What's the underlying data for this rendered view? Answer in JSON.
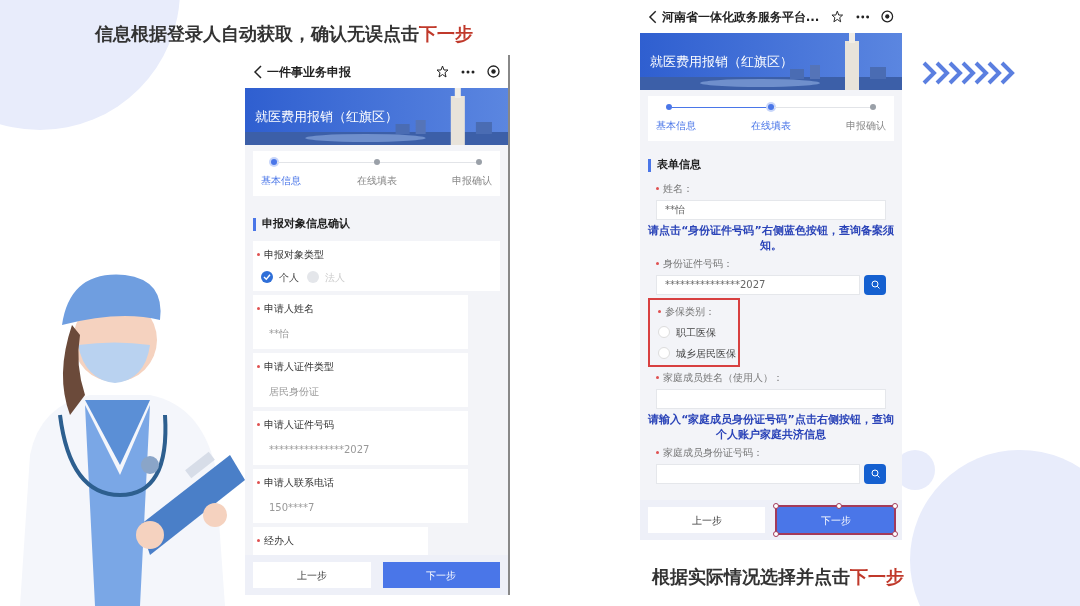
{
  "captions": [
    {
      "text": "信息根据登录人自动获取，确认无误点击",
      "highlight": "下一步"
    },
    {
      "text": "根据实际情况选择并点击",
      "highlight": "下一步"
    }
  ],
  "phones": [
    {
      "title": "一件事业务申报",
      "banner": "就医费用报销（红旗区）",
      "steps": [
        {
          "label": "基本信息",
          "completed": true,
          "current": true
        },
        {
          "label": "在线填表",
          "completed": false,
          "current": false
        },
        {
          "label": "申报确认",
          "completed": false,
          "current": false
        }
      ],
      "section": "申报对象信息确认",
      "items": [
        {
          "kind": "radio",
          "label": "申报对象类型",
          "required": true,
          "options": [
            {
              "label": "个人",
              "checked": true,
              "disabled": false
            },
            {
              "label": "法人",
              "checked": false,
              "disabled": true
            }
          ]
        },
        {
          "kind": "text",
          "label": "申请人姓名",
          "required": true,
          "value": "**怡"
        },
        {
          "kind": "text",
          "label": "申请人证件类型",
          "required": true,
          "value": "居民身份证"
        },
        {
          "kind": "text",
          "label": "申请人证件号码",
          "required": true,
          "value": "***************2027"
        },
        {
          "kind": "text",
          "label": "申请人联系电话",
          "required": true,
          "value": "150****7"
        },
        {
          "kind": "label",
          "label": "经办人",
          "required": true
        }
      ],
      "buttons": [
        {
          "label": "上一步",
          "primary": false,
          "framed": false
        },
        {
          "label": "下一步",
          "primary": true,
          "framed": false
        }
      ]
    },
    {
      "title": "河南省一体化政务服务平台...",
      "banner": "就医费用报销（红旗区）",
      "steps": [
        {
          "label": "基本信息",
          "completed": true,
          "current": false
        },
        {
          "label": "在线填表",
          "completed": true,
          "current": true
        },
        {
          "label": "申报确认",
          "completed": false,
          "current": false
        }
      ],
      "section": "表单信息",
      "items": [
        {
          "kind": "text",
          "label": "姓名：",
          "required": true,
          "value": "**怡"
        },
        {
          "kind": "notice",
          "text": "请点击“身份证件号码”右侧蓝色按钮，查询备案须知。"
        },
        {
          "kind": "search",
          "label": "身份证件号码：",
          "required": true,
          "value": "***************2027"
        },
        {
          "kind": "radio",
          "label": "参保类别：",
          "required": true,
          "marked": true,
          "options": [
            {
              "label": "职工医保",
              "checked": false,
              "disabled": false
            },
            {
              "label": "城乡居民医保",
              "checked": false,
              "disabled": false
            }
          ]
        },
        {
          "kind": "text",
          "label": "家庭成员姓名（使用人）：",
          "required": true
        },
        {
          "kind": "notice",
          "text": "请输入“家庭成员身份证号码”点击右侧按钮，查询个人账户家庭共济信息"
        },
        {
          "kind": "search",
          "label": "家庭成员身份证号码：",
          "required": true
        }
      ],
      "buttons": [
        {
          "label": "上一步",
          "primary": false,
          "framed": false
        },
        {
          "label": "下一步",
          "primary": true,
          "framed": true
        }
      ]
    }
  ]
}
